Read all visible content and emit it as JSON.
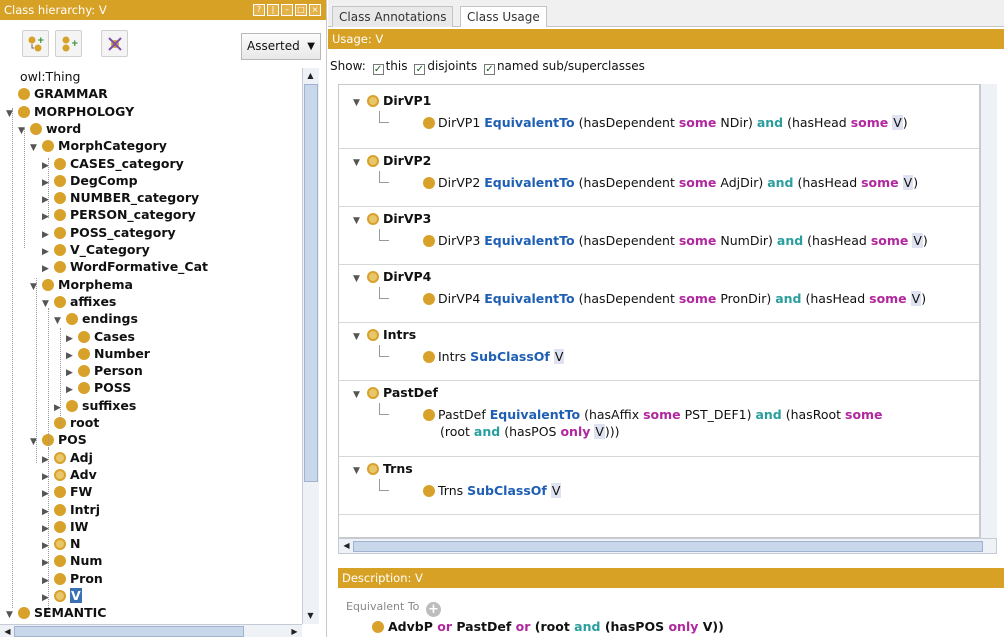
{
  "colors": {
    "accent": "#d7a126",
    "selected": "#3b6fb6",
    "kw_blue": "#1e5fb3",
    "kw_magenta": "#b0279e",
    "kw_teal": "#2a9e9e"
  },
  "left": {
    "title": "Class hierarchy: V",
    "asserted": "Asserted",
    "toolbar_icons": [
      "add-subclass-icon",
      "add-sibling-icon",
      "delete-class-icon"
    ],
    "tree": [
      {
        "label": "owl:Thing",
        "level": 0,
        "twisty": "",
        "dot": false
      },
      {
        "label": "GRAMMAR",
        "level": 0,
        "twisty": "",
        "dot": true
      },
      {
        "label": "MORPHOLOGY",
        "level": 0,
        "twisty": "▼",
        "dot": true
      },
      {
        "label": "word",
        "level": 1,
        "twisty": "▼",
        "dot": true
      },
      {
        "label": "MorphCategory",
        "level": 2,
        "twisty": "▼",
        "dot": true
      },
      {
        "label": "CASES_category",
        "level": 3,
        "twisty": "▶",
        "dot": true
      },
      {
        "label": "DegComp",
        "level": 3,
        "twisty": "▶",
        "dot": true
      },
      {
        "label": "NUMBER_category",
        "level": 3,
        "twisty": "▶",
        "dot": true
      },
      {
        "label": "PERSON_category",
        "level": 3,
        "twisty": "▶",
        "dot": true
      },
      {
        "label": "POSS_category",
        "level": 3,
        "twisty": "▶",
        "dot": true
      },
      {
        "label": "V_Category",
        "level": 3,
        "twisty": "▶",
        "dot": true
      },
      {
        "label": "WordFormative_Cat",
        "level": 3,
        "twisty": "▶",
        "dot": true
      },
      {
        "label": "Morphema",
        "level": 2,
        "twisty": "▼",
        "dot": true
      },
      {
        "label": "affixes",
        "level": 3,
        "twisty": "▼",
        "dot": true
      },
      {
        "label": "endings",
        "level": 4,
        "twisty": "▼",
        "dot": true
      },
      {
        "label": "Cases",
        "level": 5,
        "twisty": "▶",
        "dot": true
      },
      {
        "label": "Number",
        "level": 5,
        "twisty": "▶",
        "dot": true
      },
      {
        "label": "Person",
        "level": 5,
        "twisty": "▶",
        "dot": true
      },
      {
        "label": "POSS",
        "level": 5,
        "twisty": "▶",
        "dot": true
      },
      {
        "label": "suffixes",
        "level": 4,
        "twisty": "▶",
        "dot": true
      },
      {
        "label": "root",
        "level": 3,
        "twisty": "",
        "dot": true
      },
      {
        "label": "POS",
        "level": 2,
        "twisty": "▼",
        "dot": true
      },
      {
        "label": "Adj",
        "level": 3,
        "twisty": "▶",
        "dot": true,
        "defined": true
      },
      {
        "label": "Adv",
        "level": 3,
        "twisty": "▶",
        "dot": true,
        "defined": true
      },
      {
        "label": "FW",
        "level": 3,
        "twisty": "▶",
        "dot": true
      },
      {
        "label": "Intrj",
        "level": 3,
        "twisty": "▶",
        "dot": true
      },
      {
        "label": "IW",
        "level": 3,
        "twisty": "▶",
        "dot": true
      },
      {
        "label": "N",
        "level": 3,
        "twisty": "▶",
        "dot": true,
        "defined": true
      },
      {
        "label": "Num",
        "level": 3,
        "twisty": "▶",
        "dot": true
      },
      {
        "label": "Pron",
        "level": 3,
        "twisty": "▶",
        "dot": true
      },
      {
        "label": "V",
        "level": 3,
        "twisty": "▶",
        "dot": true,
        "defined": true,
        "selected": true
      },
      {
        "label": "SEMANTIC",
        "level": 0,
        "twisty": "▼",
        "dot": true
      }
    ]
  },
  "right": {
    "tabs": [
      "Class Annotations",
      "Class Usage"
    ],
    "usage_title": "Usage: V",
    "show_label": "Show:",
    "show_options": [
      "this",
      "disjoints",
      "named sub/superclasses"
    ],
    "usages": [
      {
        "name": "DirVP1",
        "axiom": [
          [
            "plain",
            "DirVP1 "
          ],
          [
            "blue",
            "EquivalentTo"
          ],
          [
            "plain",
            " (hasDependent "
          ],
          [
            "magenta",
            "some"
          ],
          [
            "plain",
            " NDir) "
          ],
          [
            "teal",
            "and"
          ],
          [
            "plain",
            " (hasHead "
          ],
          [
            "magenta",
            "some"
          ],
          [
            "plain",
            " "
          ],
          [
            "v",
            "V"
          ],
          [
            "plain",
            ")"
          ]
        ]
      },
      {
        "name": "DirVP2",
        "axiom": [
          [
            "plain",
            "DirVP2 "
          ],
          [
            "blue",
            "EquivalentTo"
          ],
          [
            "plain",
            " (hasDependent "
          ],
          [
            "magenta",
            "some"
          ],
          [
            "plain",
            " AdjDir) "
          ],
          [
            "teal",
            "and"
          ],
          [
            "plain",
            " (hasHead "
          ],
          [
            "magenta",
            "some"
          ],
          [
            "plain",
            " "
          ],
          [
            "v",
            "V"
          ],
          [
            "plain",
            ")"
          ]
        ]
      },
      {
        "name": "DirVP3",
        "axiom": [
          [
            "plain",
            "DirVP3 "
          ],
          [
            "blue",
            "EquivalentTo"
          ],
          [
            "plain",
            " (hasDependent "
          ],
          [
            "magenta",
            "some"
          ],
          [
            "plain",
            " NumDir) "
          ],
          [
            "teal",
            "and"
          ],
          [
            "plain",
            " (hasHead "
          ],
          [
            "magenta",
            "some"
          ],
          [
            "plain",
            " "
          ],
          [
            "v",
            "V"
          ],
          [
            "plain",
            ")"
          ]
        ]
      },
      {
        "name": "DirVP4",
        "axiom": [
          [
            "plain",
            "DirVP4 "
          ],
          [
            "blue",
            "EquivalentTo"
          ],
          [
            "plain",
            " (hasDependent "
          ],
          [
            "magenta",
            "some"
          ],
          [
            "plain",
            " PronDir) "
          ],
          [
            "teal",
            "and"
          ],
          [
            "plain",
            " (hasHead "
          ],
          [
            "magenta",
            "some"
          ],
          [
            "plain",
            " "
          ],
          [
            "v",
            "V"
          ],
          [
            "plain",
            ")"
          ]
        ]
      },
      {
        "name": "Intrs",
        "axiom": [
          [
            "plain",
            "Intrs "
          ],
          [
            "blue",
            "SubClassOf"
          ],
          [
            "plain",
            " "
          ],
          [
            "v",
            "V"
          ]
        ]
      },
      {
        "name": "PastDef",
        "axiom": [
          [
            "plain",
            "PastDef "
          ],
          [
            "blue",
            "EquivalentTo"
          ],
          [
            "plain",
            " (hasAffix "
          ],
          [
            "magenta",
            "some"
          ],
          [
            "plain",
            " PST_DEF1) "
          ],
          [
            "teal",
            "and"
          ],
          [
            "plain",
            " (hasRoot "
          ],
          [
            "magenta",
            "some"
          ]
        ],
        "axiom2": [
          [
            "plain",
            "(root "
          ],
          [
            "teal",
            "and"
          ],
          [
            "plain",
            " (hasPOS "
          ],
          [
            "magenta",
            "only"
          ],
          [
            "plain",
            " "
          ],
          [
            "v",
            "V"
          ],
          [
            "plain",
            ")))"
          ]
        ]
      },
      {
        "name": "Trns",
        "axiom": [
          [
            "plain",
            "Trns "
          ],
          [
            "blue",
            "SubClassOf"
          ],
          [
            "plain",
            " "
          ],
          [
            "v",
            "V"
          ]
        ]
      }
    ],
    "desc_title": "Description: V",
    "equiv_label": "Equivalent To",
    "equiv_expr": [
      [
        "plain",
        "AdvbP "
      ],
      [
        "magenta",
        "or"
      ],
      [
        "plain",
        " PastDef "
      ],
      [
        "magenta",
        "or"
      ],
      [
        "plain",
        " (root "
      ],
      [
        "teal",
        "and"
      ],
      [
        "plain",
        " (hasPOS "
      ],
      [
        "magenta",
        "only"
      ],
      [
        "plain",
        " V))"
      ]
    ]
  }
}
